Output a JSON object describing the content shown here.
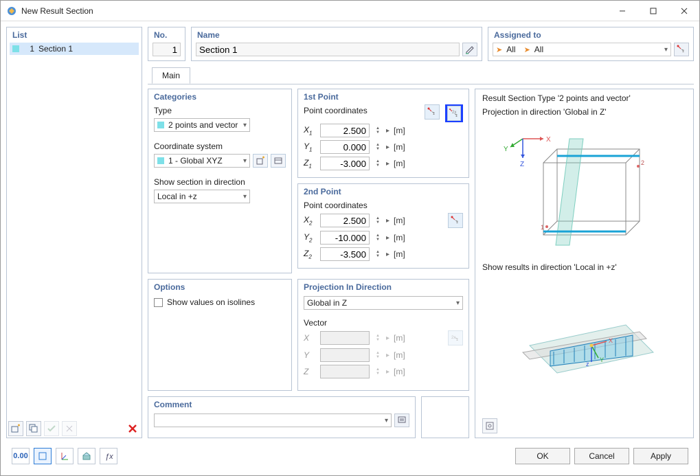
{
  "window": {
    "title": "New Result Section"
  },
  "list": {
    "header": "List",
    "items": [
      {
        "index": "1",
        "label": "Section 1"
      }
    ]
  },
  "no": {
    "header": "No.",
    "value": "1"
  },
  "name": {
    "header": "Name",
    "value": "Section 1"
  },
  "assigned": {
    "header": "Assigned to",
    "value1": "All",
    "value2": "All"
  },
  "tabs": {
    "main": "Main"
  },
  "categories": {
    "header": "Categories",
    "type_label": "Type",
    "type_value": "2 points and vector",
    "coord_label": "Coordinate system",
    "coord_value": "1 - Global XYZ",
    "show_label": "Show section in direction",
    "show_value": "Local in +z"
  },
  "point1": {
    "header": "1st Point",
    "coords_label": "Point coordinates",
    "x_label": "X",
    "x_sub": "1",
    "x_value": "2.500",
    "x_unit": "[m]",
    "y_label": "Y",
    "y_sub": "1",
    "y_value": "0.000",
    "y_unit": "[m]",
    "z_label": "Z",
    "z_sub": "1",
    "z_value": "-3.000",
    "z_unit": "[m]"
  },
  "point2": {
    "header": "2nd Point",
    "coords_label": "Point coordinates",
    "x_label": "X",
    "x_sub": "2",
    "x_value": "2.500",
    "x_unit": "[m]",
    "y_label": "Y",
    "y_sub": "2",
    "y_value": "-10.000",
    "y_unit": "[m]",
    "z_label": "Z",
    "z_sub": "2",
    "z_value": "-3.500",
    "z_unit": "[m]"
  },
  "options": {
    "header": "Options",
    "show_iso_label": "Show values on isolines"
  },
  "projection": {
    "header": "Projection In Direction",
    "select_value": "Global in Z",
    "vector_label": "Vector",
    "x_label": "X",
    "x_unit": "[m]",
    "y_label": "Y",
    "y_unit": "[m]",
    "z_label": "Z",
    "z_unit": "[m]"
  },
  "preview": {
    "line1": "Result Section Type '2 points and vector'",
    "line2": "Projection in direction 'Global in Z'",
    "line3": "Show results in direction 'Local in +z'",
    "axis_x": "X",
    "axis_y": "Y",
    "axis_z": "Z",
    "pt1": "1",
    "pt2": "2",
    "axis_x2": "X",
    "axis_y2": "Y",
    "axis_z2": "z"
  },
  "comment": {
    "header": "Comment"
  },
  "footer": {
    "ok": "OK",
    "cancel": "Cancel",
    "apply": "Apply",
    "tool_000": "0.00"
  }
}
